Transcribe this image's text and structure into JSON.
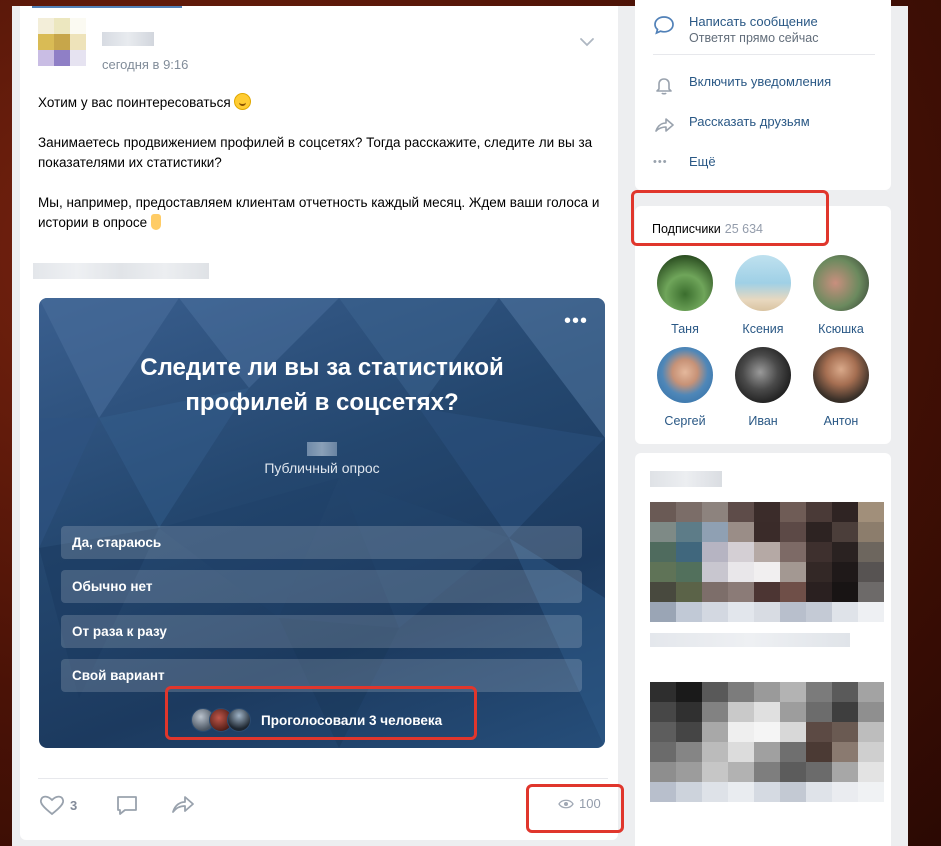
{
  "post": {
    "time": "сегодня в 9:16",
    "paragraphs": [
      "Хотим у вас поинтересоваться",
      "Занимаетесь продвижением профилей в соцсетях? Тогда расскажите, следите ли вы за показателями их статистики?",
      "Мы, например, предоставляем клиентам отчетность каждый месяц. Ждем ваши голоса и истории в опросе"
    ],
    "poll": {
      "title": "Следите ли вы за статистикой профилей в соцсетях?",
      "type": "Публичный опрос",
      "options": [
        "Да, стараюсь",
        "Обычно нет",
        "От раза к разу",
        "Свой вариант"
      ],
      "voters_label": "Проголосовали 3 человека",
      "more_icon": "more-dots-icon"
    },
    "likes": "3",
    "views": "100",
    "icons": {
      "like": "heart-icon",
      "comment": "comment-icon",
      "share": "share-arrow-icon",
      "views": "eye-icon",
      "expand": "chevron-down-icon"
    }
  },
  "sidebar": {
    "write_message": "Написать сообщение",
    "write_message_sub": "Ответят прямо сейчас",
    "notifications": "Включить уведомления",
    "tell_friends": "Рассказать друзьям",
    "more": "Ещё",
    "subscribers_label": "Подписчики",
    "subscribers_count": "25 634",
    "members": [
      "Таня",
      "Ксения",
      "Ксюшка",
      "Сергей",
      "Иван",
      "Антон"
    ]
  },
  "colors": {
    "link": "#2a5885",
    "highlight": "#e0362c",
    "poll_bg": "#24476f"
  }
}
